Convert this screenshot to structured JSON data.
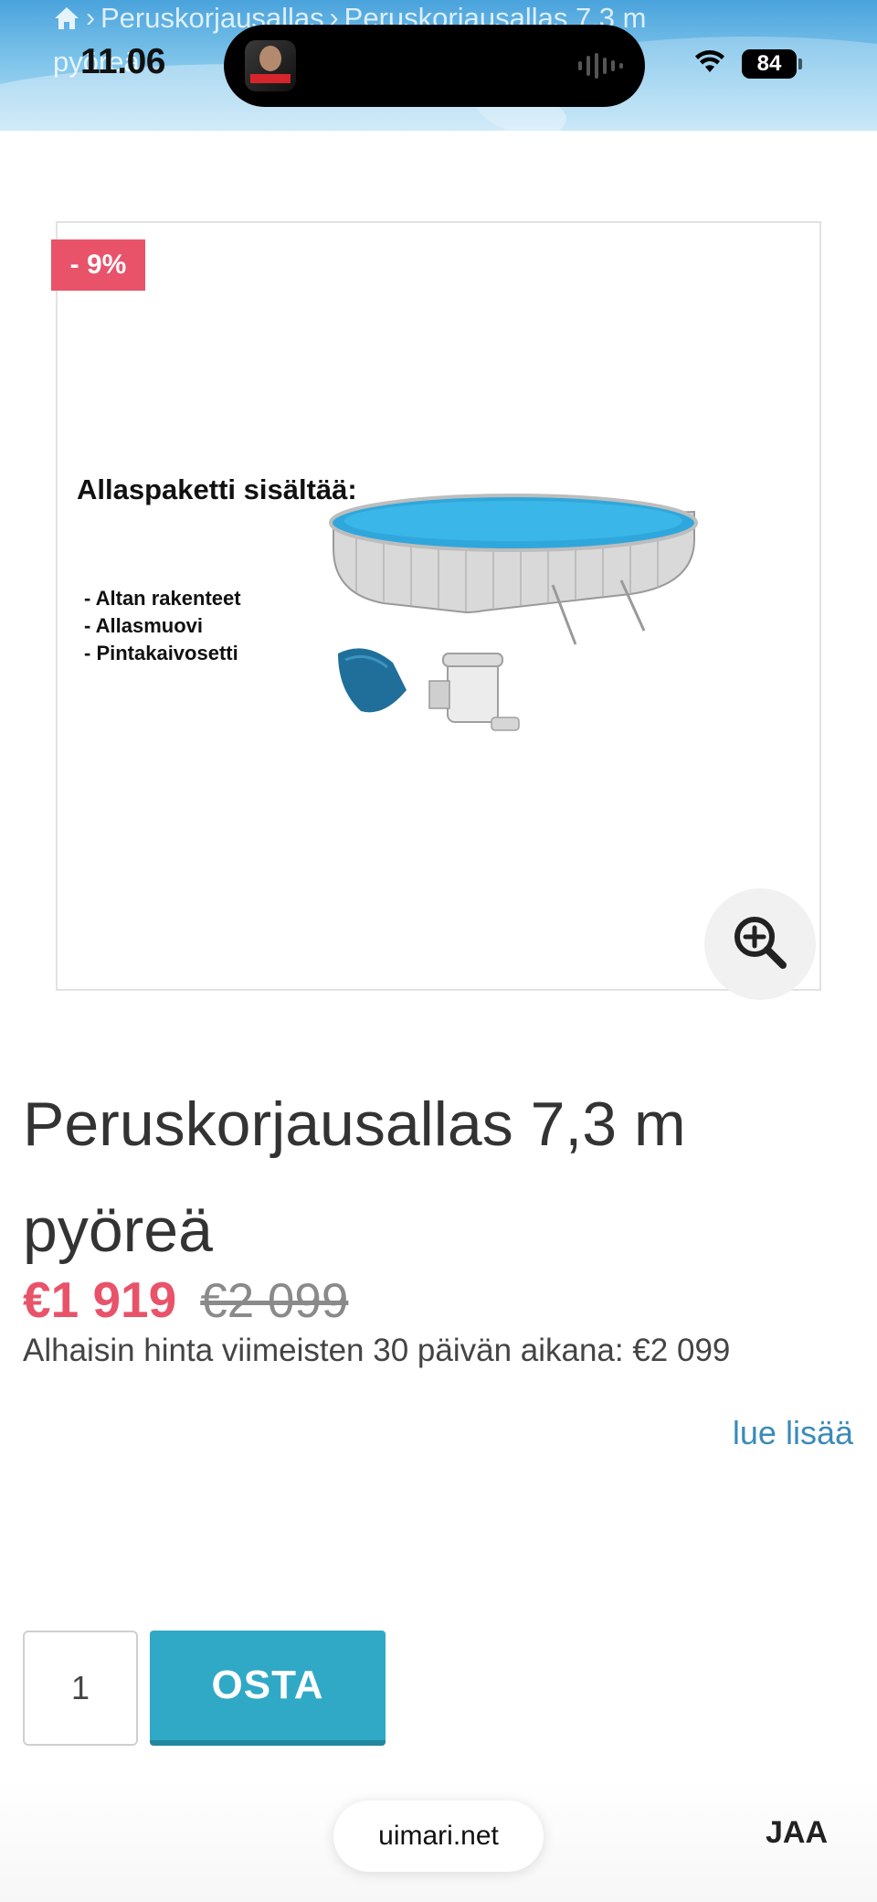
{
  "status_bar": {
    "time": "11.06",
    "battery": "84"
  },
  "breadcrumb": {
    "items": [
      "Peruskorjausallas",
      "Peruskorjausallas 7,3 m"
    ],
    "overflow": "pyöreä"
  },
  "product": {
    "discount_badge": "- 9%",
    "image_heading": "Allaspaketti sisältää:",
    "image_items": [
      "- Altan rakenteet",
      "- Allasmuovi",
      "- Pintakaivosetti"
    ],
    "title": "Peruskorjausallas 7,3 m pyöreä",
    "price_sale": "€1 919",
    "price_old": "€2 099",
    "lowest_price_text": "Alhaisin hinta viimeisten 30 päivän aikana: €2 099",
    "read_more": "lue lisää"
  },
  "buy": {
    "quantity": "1",
    "button_label": "OSTA"
  },
  "browser": {
    "url": "uimari.net",
    "share_label": "JAA"
  },
  "colors": {
    "accent_sale": "#e8536a",
    "buy_button": "#2fa9c6",
    "link": "#3b8bb8"
  }
}
